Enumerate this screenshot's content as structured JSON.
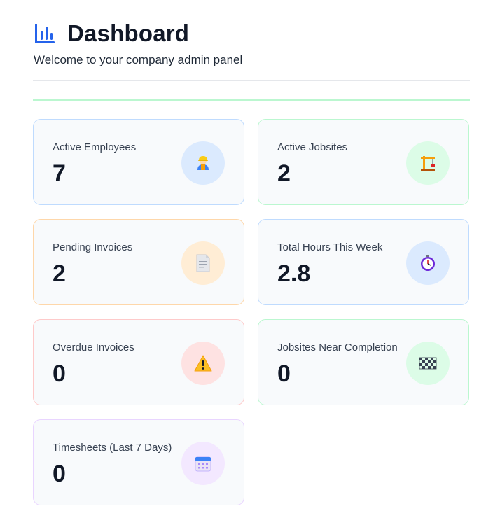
{
  "header": {
    "title": "Dashboard",
    "subtitle": "Welcome to your company admin panel",
    "icon": "bar-chart-icon",
    "icon_color": "#2563eb"
  },
  "cards": [
    {
      "label": "Active Employees",
      "value": "7",
      "icon": "construction-worker-icon",
      "accent": "#bfdbfe"
    },
    {
      "label": "Active Jobsites",
      "value": "2",
      "icon": "crane-icon",
      "accent": "#bbf7d0"
    },
    {
      "label": "Pending Invoices",
      "value": "2",
      "icon": "document-icon",
      "accent": "#fed7aa"
    },
    {
      "label": "Total Hours This Week",
      "value": "2.8",
      "icon": "stopwatch-icon",
      "accent": "#bfdbfe"
    },
    {
      "label": "Overdue Invoices",
      "value": "0",
      "icon": "warning-icon",
      "accent": "#fecaca"
    },
    {
      "label": "Jobsites Near Completion",
      "value": "0",
      "icon": "checkered-flag-icon",
      "accent": "#bbf7d0"
    },
    {
      "label": "Timesheets (Last 7 Days)",
      "value": "0",
      "icon": "calendar-icon",
      "accent": "#e9d5ff"
    }
  ]
}
